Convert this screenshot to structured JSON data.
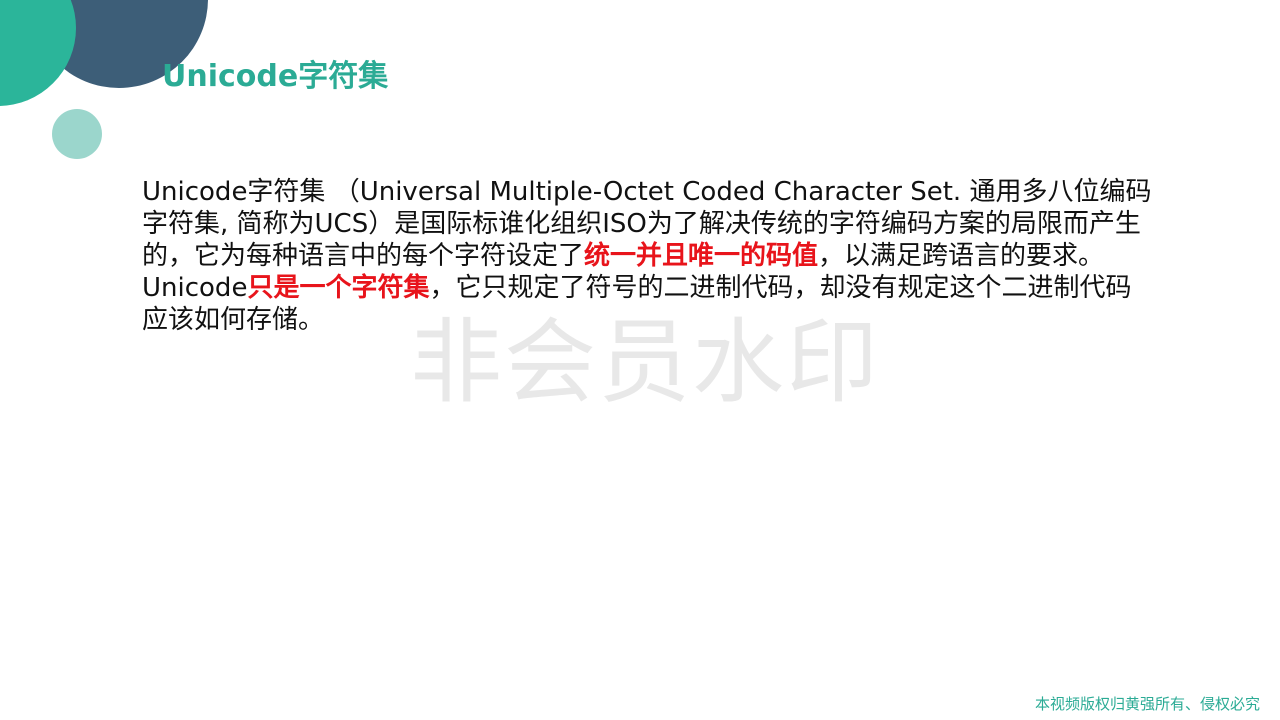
{
  "slide": {
    "title": "Unicode字符集",
    "body": {
      "line1": "Unicode字符集 （Universal  Multiple-Octet Coded Character Set. 通用多八位编码",
      "line2": "字符集, 简称为UCS）是国际标谁化组织ISO为了解决传统的字符编码方案的局限而产生",
      "line3_pre": "的，它为每种语言中的每个字符设定了",
      "line3_emph": "统一并且唯一的码值",
      "line3_post": "，以满足跨语言的要求。",
      "line4_pre": "Unicode",
      "line4_emph": "只是一个字符集",
      "line4_post": "，它只规定了符号的二进制代码，却没有规定这个二进制代码",
      "line5": "应该如何存储。"
    },
    "watermark": "非会员水印",
    "copyright": "本视频版权归黄强所有、侵权必究"
  },
  "colors": {
    "title": "#2bab95",
    "emphasis": "#e8141b",
    "circle_dark": "#3d5e78",
    "circle_teal": "#2bb59a",
    "circle_light": "#9bd6cc"
  }
}
